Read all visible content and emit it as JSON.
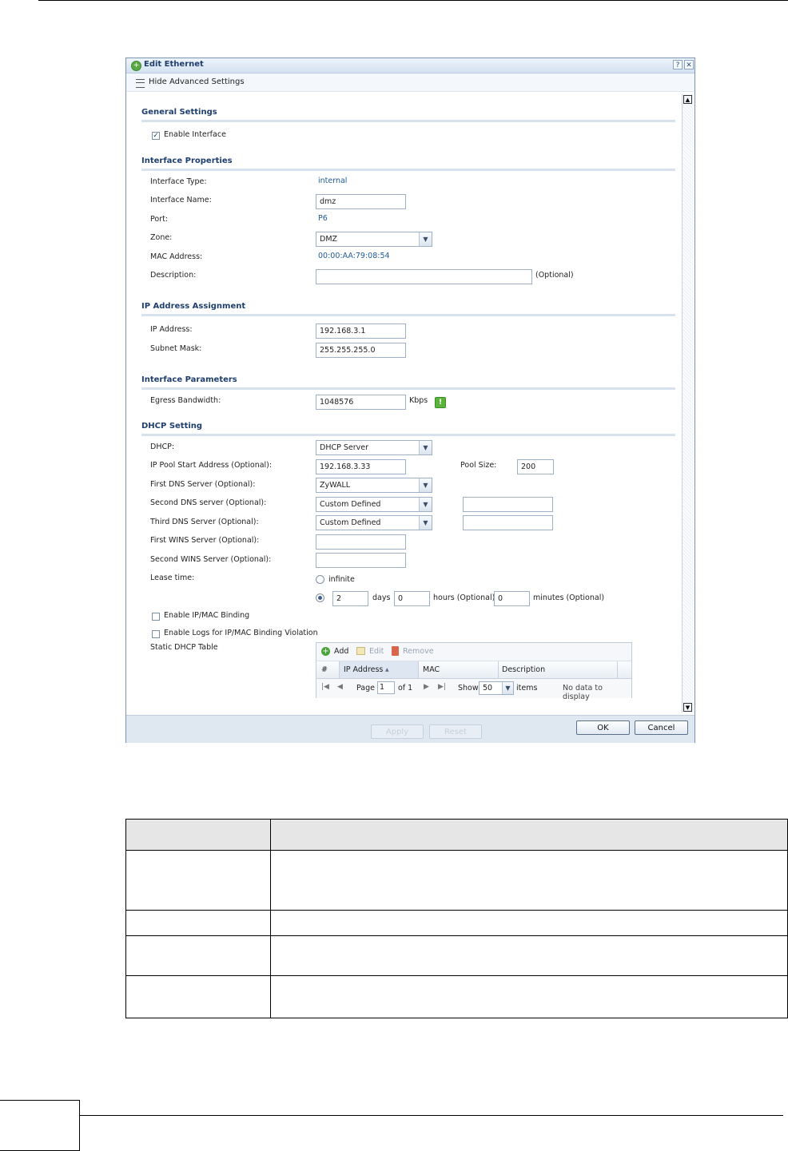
{
  "dialog": {
    "title": "Edit Ethernet",
    "help_glyph": "?",
    "close_glyph": "✕",
    "toolbar_label": "Hide Advanced Settings"
  },
  "sections": {
    "general": "General Settings",
    "properties": "Interface Properties",
    "ip": "IP Address Assignment",
    "params": "Interface Parameters",
    "dhcp": "DHCP Setting"
  },
  "general": {
    "enable_interface_label": "Enable Interface",
    "enable_interface_checked": true
  },
  "properties": {
    "type_label": "Interface Type:",
    "type_value": "internal",
    "name_label": "Interface Name:",
    "name_value": "dmz",
    "port_label": "Port:",
    "port_value": "P6",
    "zone_label": "Zone:",
    "zone_value": "DMZ",
    "mac_label": "MAC Address:",
    "mac_value": "00:00:AA:79:08:54",
    "desc_label": "Description:",
    "desc_value": "",
    "desc_hint": "(Optional)"
  },
  "ip": {
    "ip_label": "IP Address:",
    "ip_value": "192.168.3.1",
    "mask_label": "Subnet Mask:",
    "mask_value": "255.255.255.0"
  },
  "params": {
    "egress_label": "Egress Bandwidth:",
    "egress_value": "1048576",
    "egress_unit": "Kbps"
  },
  "dhcp": {
    "dhcp_label": "DHCP:",
    "dhcp_value": "DHCP Server",
    "pool_start_label": "IP Pool Start Address (Optional):",
    "pool_start_value": "192.168.3.33",
    "pool_size_label": "Pool Size:",
    "pool_size_value": "200",
    "dns1_label": "First DNS Server (Optional):",
    "dns1_value": "ZyWALL",
    "dns2_label": "Second DNS server (Optional):",
    "dns2_value": "Custom Defined",
    "dns2_custom": "",
    "dns3_label": "Third DNS Server (Optional):",
    "dns3_value": "Custom Defined",
    "dns3_custom": "",
    "wins1_label": "First WINS Server (Optional):",
    "wins1_value": "",
    "wins2_label": "Second WINS Server (Optional):",
    "wins2_value": "",
    "lease_label": "Lease time:",
    "lease_infinite_label": "infinite",
    "lease_days_value": "2",
    "lease_days_label": "days",
    "lease_hours_value": "0",
    "lease_hours_label": "hours (Optional)",
    "lease_minutes_value": "0",
    "lease_minutes_label": "minutes (Optional)",
    "ipmac_binding_label": "Enable IP/MAC Binding",
    "ipmac_logs_label": "Enable Logs for IP/MAC Binding Violation",
    "static_table_label": "Static DHCP Table"
  },
  "static_table": {
    "add_label": "Add",
    "edit_label": "Edit",
    "remove_label": "Remove",
    "columns": [
      "#",
      "IP Address",
      "MAC",
      "Description"
    ],
    "sort_glyph": "▲",
    "page_label": "Page",
    "page_value": "1",
    "of_label": "of 1",
    "show_label": "Show",
    "show_value": "50",
    "items_label": "items",
    "empty_text": "No data to display"
  },
  "footer": {
    "apply": "Apply",
    "reset": "Reset",
    "ok": "OK",
    "cancel": "Cancel"
  },
  "colors": {
    "accent": "#1e3f6e",
    "link_value": "#1f5b99",
    "footer_bg": "#dfe7f1"
  }
}
